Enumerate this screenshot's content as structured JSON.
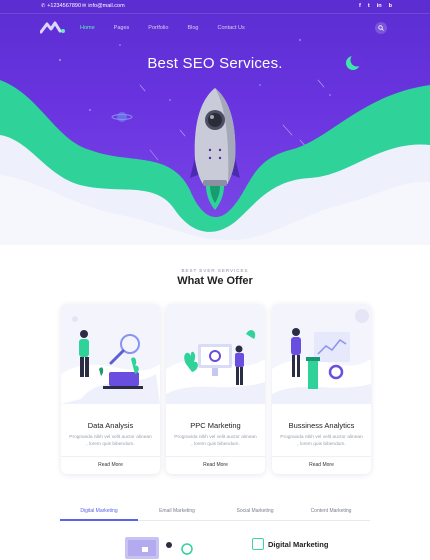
{
  "topbar": {
    "phone": "+1234567890",
    "email": "info@mail.com",
    "socials": [
      "f",
      "t",
      "in",
      "b"
    ]
  },
  "nav": {
    "items": [
      "Home",
      "Pages",
      "Portfolio",
      "Blog",
      "Contact Us"
    ],
    "active_index": 0
  },
  "hero": {
    "title": "Best SEO Services."
  },
  "services": {
    "eyebrow": "BEST EVER SERVICES",
    "title": "What We Offer",
    "cards": [
      {
        "title": "Data Analysis",
        "desc": "Progravida nibh vel velit auctor alinean , lorem quis bibendum.",
        "link": "Read More"
      },
      {
        "title": "PPC Marketing",
        "desc": "Progravida nibh vel velit auctor alinean , lorem quis bibendum.",
        "link": "Read More"
      },
      {
        "title": "Bussiness Analytics",
        "desc": "Progravida nibh vel velit auctor alinean , lorem quis bibendum.",
        "link": "Read More"
      }
    ]
  },
  "tabs": {
    "items": [
      "Digital Marketing",
      "Email Marketing",
      "Social Marketing",
      "Content Marketing"
    ],
    "active_index": 0
  },
  "feature": {
    "title": "Digital Marketing"
  },
  "colors": {
    "brand_purple": "#5b2ed1",
    "accent_green": "#2fd39a",
    "tab_active": "#5b63e6"
  }
}
